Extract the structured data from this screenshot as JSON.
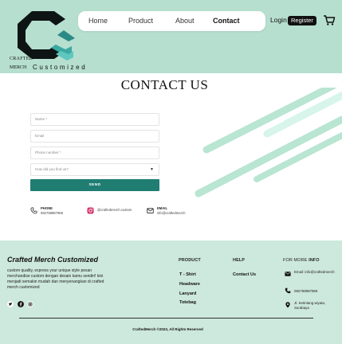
{
  "brand": {
    "logo_line1": "CRAFTED",
    "logo_line2": "MERCH",
    "logo_line3": "Customized"
  },
  "nav": {
    "items": [
      {
        "label": "Home"
      },
      {
        "label": "Product"
      },
      {
        "label": "About"
      },
      {
        "label": "Contact"
      }
    ],
    "active": "Contact",
    "login_label": "Login",
    "register_label": "Register"
  },
  "page": {
    "title": "CONTACT US"
  },
  "form": {
    "name_placeholder": "Name *",
    "email_placeholder": "Email",
    "phone_placeholder": "Phone number *",
    "source_placeholder": "How did you find us?",
    "send_label": "SEND"
  },
  "contact": {
    "phone_label": "PHONE",
    "phone_value": "082768987969",
    "instagram_value": "@craftedmerch.custom",
    "email_label": "EMAIL",
    "email_value": "info@craftedmerch"
  },
  "footer": {
    "brand_title": "Crafted Merch Customized",
    "description": "custom quality, express your unique style pesan merchandise custom dengan desain kamu sendiri! kini menjadi semakin mudah dan menyenangkan di crafted merch customized",
    "product_heading": "PRODUCT",
    "product_links": [
      "T - Shirt",
      "Headware",
      "Lanyard",
      "Totebag"
    ],
    "help_heading": "HELP",
    "help_links": [
      "Contact Us"
    ],
    "info_heading_normal": "FOR MORE ",
    "info_heading_bold": "INFO",
    "info_email": "Email: info@craftedmerch",
    "info_phone": "082768987969",
    "info_address": "Jl. Ketintang wiyata, Surabaya",
    "copyright": "CraftedMerch ©2023, All Rights Reserved"
  },
  "colors": {
    "header_bg": "#b6dfcf",
    "footer_bg": "#cde8dd",
    "accent_teal": "#1f7d72",
    "stripe_light": "#b9e5d3",
    "stripe_pale": "#d7f5ea"
  }
}
